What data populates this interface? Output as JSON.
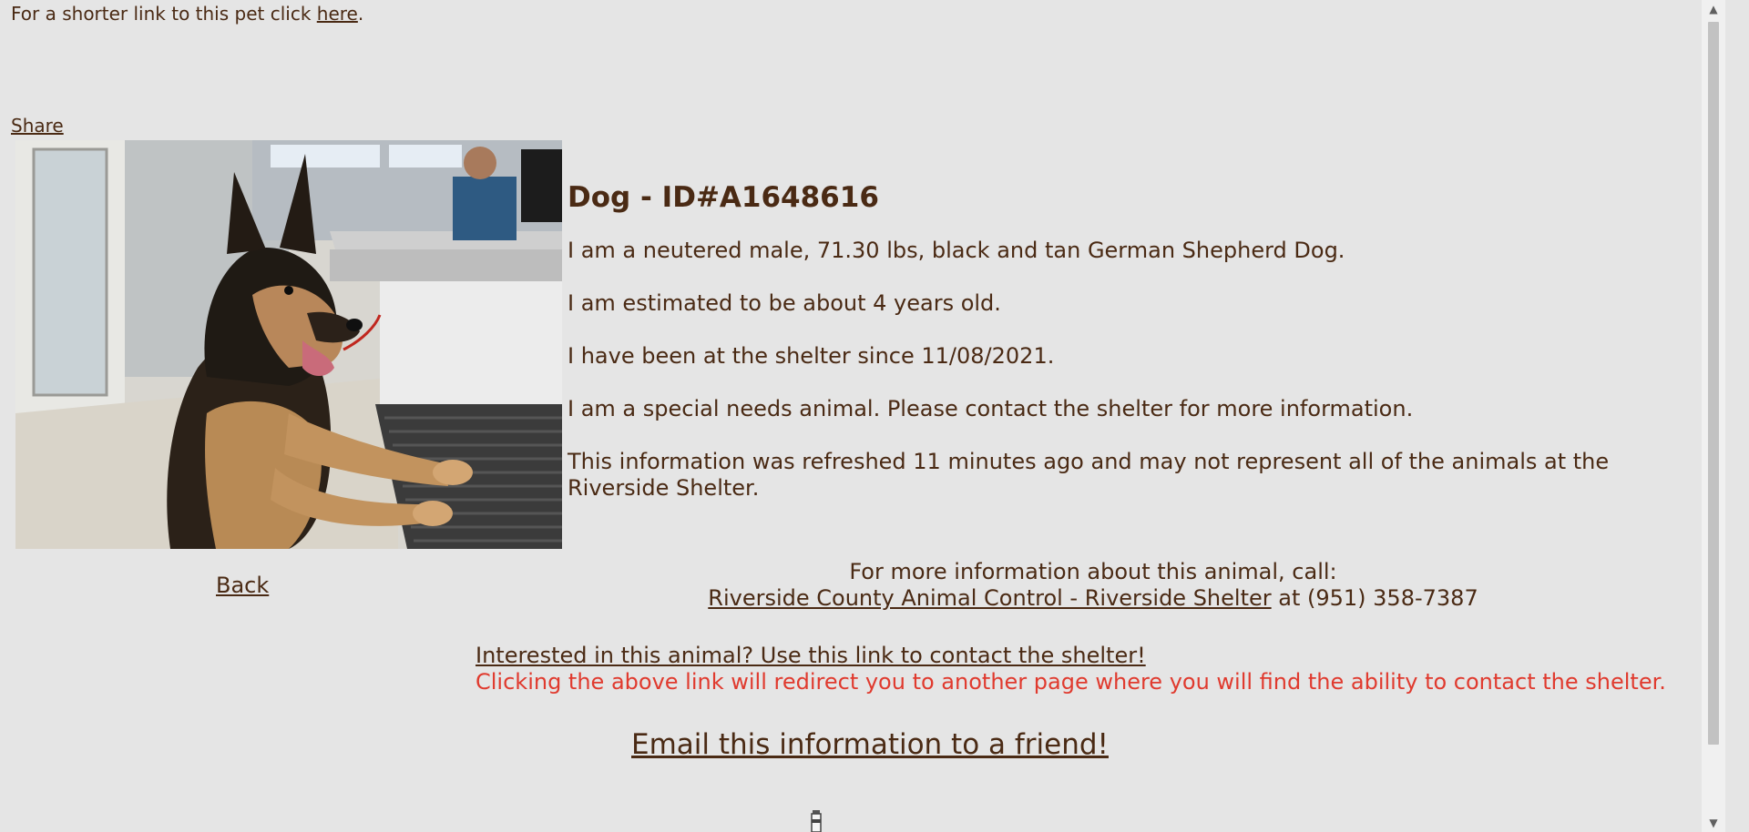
{
  "header": {
    "short_link_text": "For a shorter link to this pet click ",
    "short_link_anchor": "here",
    "short_link_suffix": ".",
    "share_label": "Share"
  },
  "animal": {
    "title": "Dog - ID#A1648616",
    "description": "I am a neutered male, 71.30 lbs, black and tan German Shepherd Dog.",
    "age": "I am estimated to be about 4 years old.",
    "since": "I have been at the shelter since 11/08/2021.",
    "special_needs": "I am a special needs animal. Please contact the shelter for more information.",
    "refreshed": "This information was refreshed 11 minutes ago and may not represent all of the animals at the Riverside Shelter."
  },
  "nav": {
    "back_label": "Back"
  },
  "contact": {
    "intro": "For more information about this animal, call:",
    "shelter_link": "Riverside County Animal Control - Riverside Shelter",
    "phone_text": " at (951) 358-7387"
  },
  "interest": {
    "link_text": "Interested in this animal? Use this link to contact the shelter!",
    "warning_text": "Clicking the above link will redirect you to another page where you will find the ability to contact the shelter.",
    "warning_color": "#e03a2e"
  },
  "email": {
    "label": "Email this information to a friend!"
  },
  "icons": {
    "photo": "german-shepherd-dog-photo",
    "scroll_up": "scroll-up-arrow-icon",
    "scroll_down": "scroll-down-arrow-icon"
  },
  "theme": {
    "background": "#e5e5e5",
    "text": "#4a2a14"
  }
}
